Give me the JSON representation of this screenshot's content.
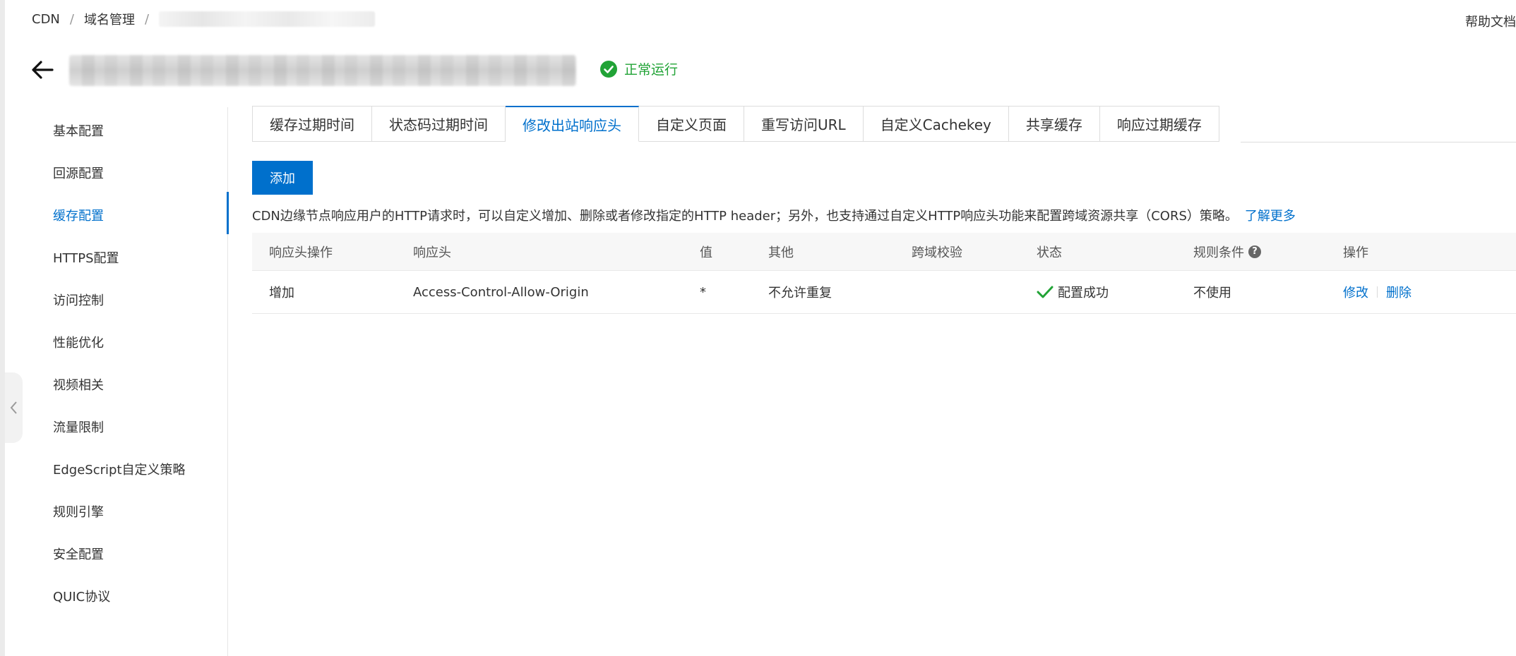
{
  "breadcrumb": {
    "root": "CDN",
    "section": "域名管理",
    "current_domain": ""
  },
  "header": {
    "help": "帮助文档",
    "domain_title": "",
    "status": "正常运行"
  },
  "sidebar": {
    "items": [
      {
        "label": "基本配置"
      },
      {
        "label": "回源配置"
      },
      {
        "label": "缓存配置",
        "active": true
      },
      {
        "label": "HTTPS配置"
      },
      {
        "label": "访问控制"
      },
      {
        "label": "性能优化"
      },
      {
        "label": "视频相关"
      },
      {
        "label": "流量限制"
      },
      {
        "label": "EdgeScript自定义策略"
      },
      {
        "label": "规则引擎"
      },
      {
        "label": "安全配置"
      },
      {
        "label": "QUIC协议"
      }
    ]
  },
  "tabs": [
    {
      "label": "缓存过期时间"
    },
    {
      "label": "状态码过期时间"
    },
    {
      "label": "修改出站响应头",
      "active": true
    },
    {
      "label": "自定义页面"
    },
    {
      "label": "重写访问URL"
    },
    {
      "label": "自定义Cachekey"
    },
    {
      "label": "共享缓存"
    },
    {
      "label": "响应过期缓存"
    }
  ],
  "toolbar": {
    "add_label": "添加"
  },
  "description": {
    "text": "CDN边缘节点响应用户的HTTP请求时，可以自定义增加、删除或者修改指定的HTTP header；另外，也支持通过自定义HTTP响应头功能来配置跨域资源共享（CORS）策略。",
    "more": "了解更多"
  },
  "table": {
    "headers": {
      "op": "响应头操作",
      "header": "响应头",
      "value": "值",
      "other": "其他",
      "cors": "跨域校验",
      "status": "状态",
      "rule": "规则条件",
      "actions": "操作"
    },
    "rows": [
      {
        "op": "增加",
        "header": "Access-Control-Allow-Origin",
        "value": "*",
        "other": "不允许重复",
        "cors": "",
        "status": "配置成功",
        "rule": "不使用",
        "edit": "修改",
        "delete": "删除"
      }
    ]
  },
  "colors": {
    "accent": "#0070cc",
    "success": "#21a336"
  },
  "icons": {
    "back": "arrow-left-icon",
    "status": "check-circle-icon",
    "row_status": "check-icon",
    "help": "question-circle-icon",
    "collapse": "chevron-left-icon"
  }
}
